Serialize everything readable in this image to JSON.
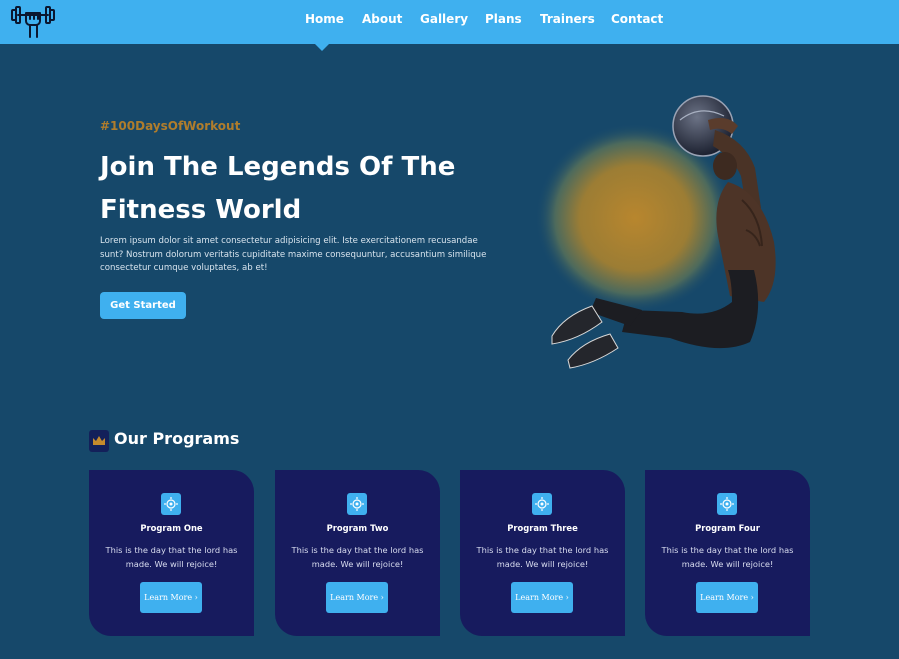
{
  "nav": {
    "items": [
      {
        "label": "Home"
      },
      {
        "label": "About"
      },
      {
        "label": "Gallery"
      },
      {
        "label": "Plans"
      },
      {
        "label": "Trainers"
      },
      {
        "label": "Contact"
      }
    ],
    "active": "Home",
    "logo_icon": "dumbbell-fist-icon"
  },
  "hero": {
    "hashtag": "#100DaysOfWorkout",
    "title": "Join The Legends Of The Fitness World",
    "text": "Lorem ipsum dolor sit amet consectetur adipisicing elit. Iste exercitationem recusandae sunt? Nostrum dolorum veritatis cupiditate maxime consequuntur, accusantium similique consectetur cumque voluptates, ab et!",
    "button": "Get Started",
    "image": "athlete-with-medicine-ball"
  },
  "programs": {
    "title": "Our Programs",
    "header_icon": "crown-icon",
    "card_icon": "gear-icon",
    "cards": [
      {
        "name": "Program One",
        "desc": "This is the day that the lord has made. We will rejoice!",
        "button": "Learn More ›"
      },
      {
        "name": "Program Two",
        "desc": "This is the day that the lord has made. We will rejoice!",
        "button": "Learn More ›"
      },
      {
        "name": "Program Three",
        "desc": "This is the day that the lord has made. We will rejoice!",
        "button": "Learn More ›"
      },
      {
        "name": "Program Four",
        "desc": "This is the day that the lord has made. We will rejoice!",
        "button": "Learn More ›"
      }
    ]
  },
  "colors": {
    "background": "#16486a",
    "nav": "#3fb0ef",
    "accent": "#3fb0ef",
    "hashtag": "#b07d2c",
    "card": "#171b5e",
    "glow": "#b8862e"
  }
}
